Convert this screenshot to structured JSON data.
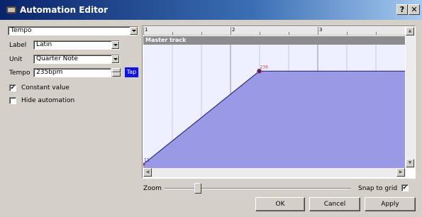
{
  "window": {
    "title": "Automation Editor",
    "help_label": "?",
    "close_label": "✕"
  },
  "left": {
    "parameter_value": "Tempo",
    "label_caption": "Label",
    "label_value": "Latin",
    "unit_caption": "Unit",
    "unit_value": "Quarter Note",
    "tempo_caption": "Tempo",
    "tempo_value": "235bpm",
    "tap_label": "Tap",
    "constant_value_label": "Constant value",
    "constant_value_checked": true,
    "hide_automation_label": "Hide automation",
    "hide_automation_checked": false
  },
  "editor": {
    "ruler_labels": [
      "1",
      "2",
      "3"
    ],
    "track_name": "Master track",
    "point_labels": [
      "11",
      "236"
    ],
    "colors": {
      "fill": "#9999e6",
      "line": "#2a2a8a",
      "background": "#eef0ff",
      "point": "#d04040"
    }
  },
  "chart_data": {
    "type": "area",
    "x": [
      0,
      1.33,
      3
    ],
    "values": [
      11,
      236,
      236
    ],
    "xlabel": "",
    "ylabel": "",
    "xlim": [
      0,
      3
    ],
    "ylim": [
      0,
      300
    ],
    "grid": true
  },
  "bottom": {
    "zoom_label": "Zoom",
    "snap_label": "Snap to grid",
    "snap_checked": true,
    "ok_label": "OK",
    "cancel_label": "Cancel",
    "apply_label": "Apply"
  }
}
